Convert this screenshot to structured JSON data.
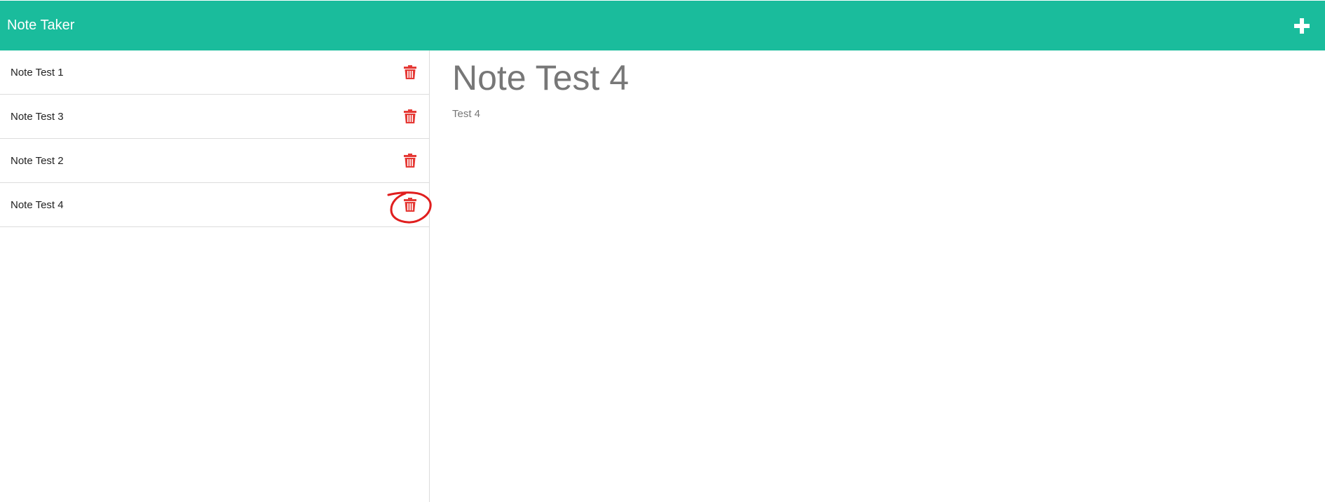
{
  "navbar": {
    "brand": "Note Taker",
    "new_note_icon": "plus-icon"
  },
  "sidebar": {
    "notes": [
      {
        "title": "Note Test 1",
        "delete_icon": "trash-icon"
      },
      {
        "title": "Note Test 3",
        "delete_icon": "trash-icon"
      },
      {
        "title": "Note Test 2",
        "delete_icon": "trash-icon"
      },
      {
        "title": "Note Test 4",
        "delete_icon": "trash-icon"
      }
    ]
  },
  "active_note": {
    "title": "Note Test 4",
    "text": "Test 4"
  },
  "colors": {
    "navbar_bg": "#1abc9c",
    "trash": "#e53935",
    "annotation": "#e01e1e",
    "heading_text": "#777777"
  }
}
